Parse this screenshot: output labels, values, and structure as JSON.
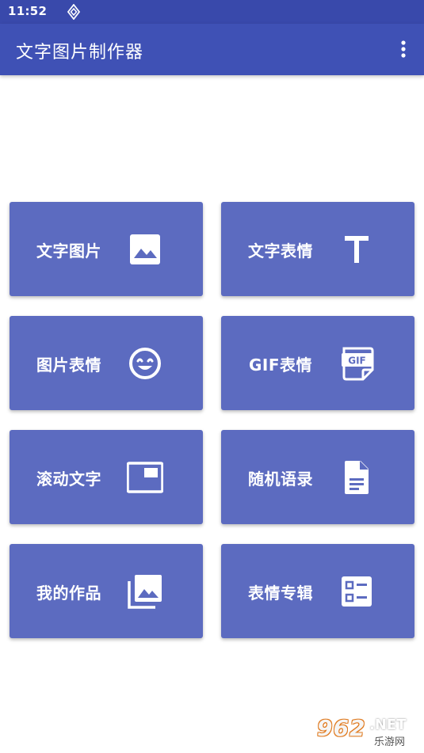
{
  "status_bar": {
    "time": "11:52"
  },
  "app_bar": {
    "title": "文字图片制作器"
  },
  "tiles": [
    {
      "label": "文字图片",
      "icon": "image-icon"
    },
    {
      "label": "文字表情",
      "icon": "text-t-icon"
    },
    {
      "label": "图片表情",
      "icon": "smiley-icon"
    },
    {
      "label": "GIF表情",
      "icon": "gif-file-icon"
    },
    {
      "label": "滚动文字",
      "icon": "picture-in-picture-icon"
    },
    {
      "label": "随机语录",
      "icon": "document-icon"
    },
    {
      "label": "我的作品",
      "icon": "photo-library-icon"
    },
    {
      "label": "表情专辑",
      "icon": "list-card-icon"
    }
  ],
  "watermark": {
    "number": "962",
    "net": ".NET",
    "sub": "乐游网"
  },
  "colors": {
    "status_bar": "#3949ab",
    "app_bar": "#3f51b5",
    "tile": "#5c6bc0",
    "text": "#ffffff"
  }
}
